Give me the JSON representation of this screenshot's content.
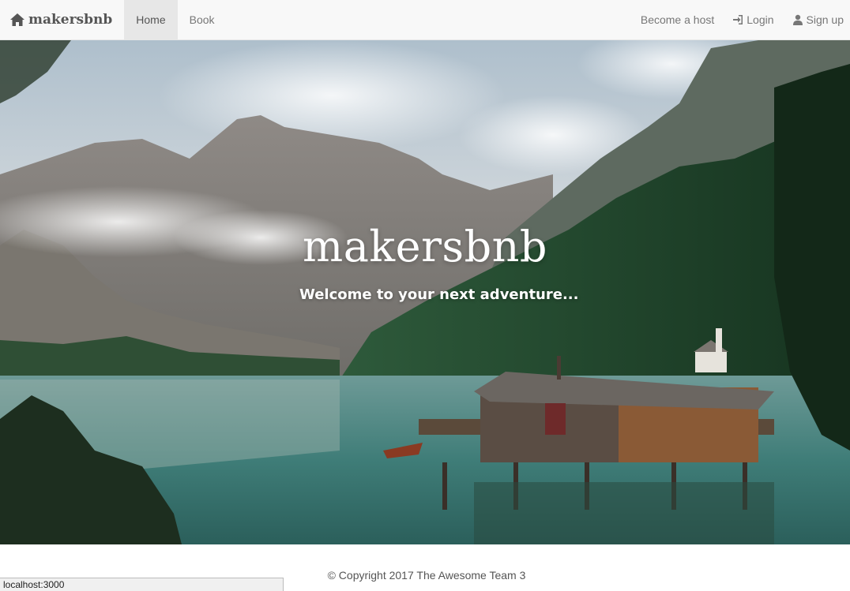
{
  "navbar": {
    "brand": {
      "icon": "home-icon",
      "label": "makersbnb"
    },
    "left_items": [
      {
        "label": "Home",
        "active": true
      },
      {
        "label": "Book",
        "active": false
      }
    ],
    "right_items": {
      "host": {
        "label": "Become a host"
      },
      "login": {
        "icon": "login-icon",
        "label": "Login"
      },
      "signup": {
        "icon": "user-icon",
        "label": "Sign up"
      }
    }
  },
  "hero": {
    "title": "makersbnb",
    "subtitle": "Welcome to your next adventure..."
  },
  "footer": {
    "copyright": "© Copyright 2017 The Awesome Team 3"
  },
  "statusbar": {
    "url": "localhost:3000"
  },
  "colors": {
    "navbar_bg": "#f8f8f8",
    "active_tab_bg": "#e7e7e7",
    "lake": "#3f7d78",
    "forest": "#1f4a2e"
  }
}
